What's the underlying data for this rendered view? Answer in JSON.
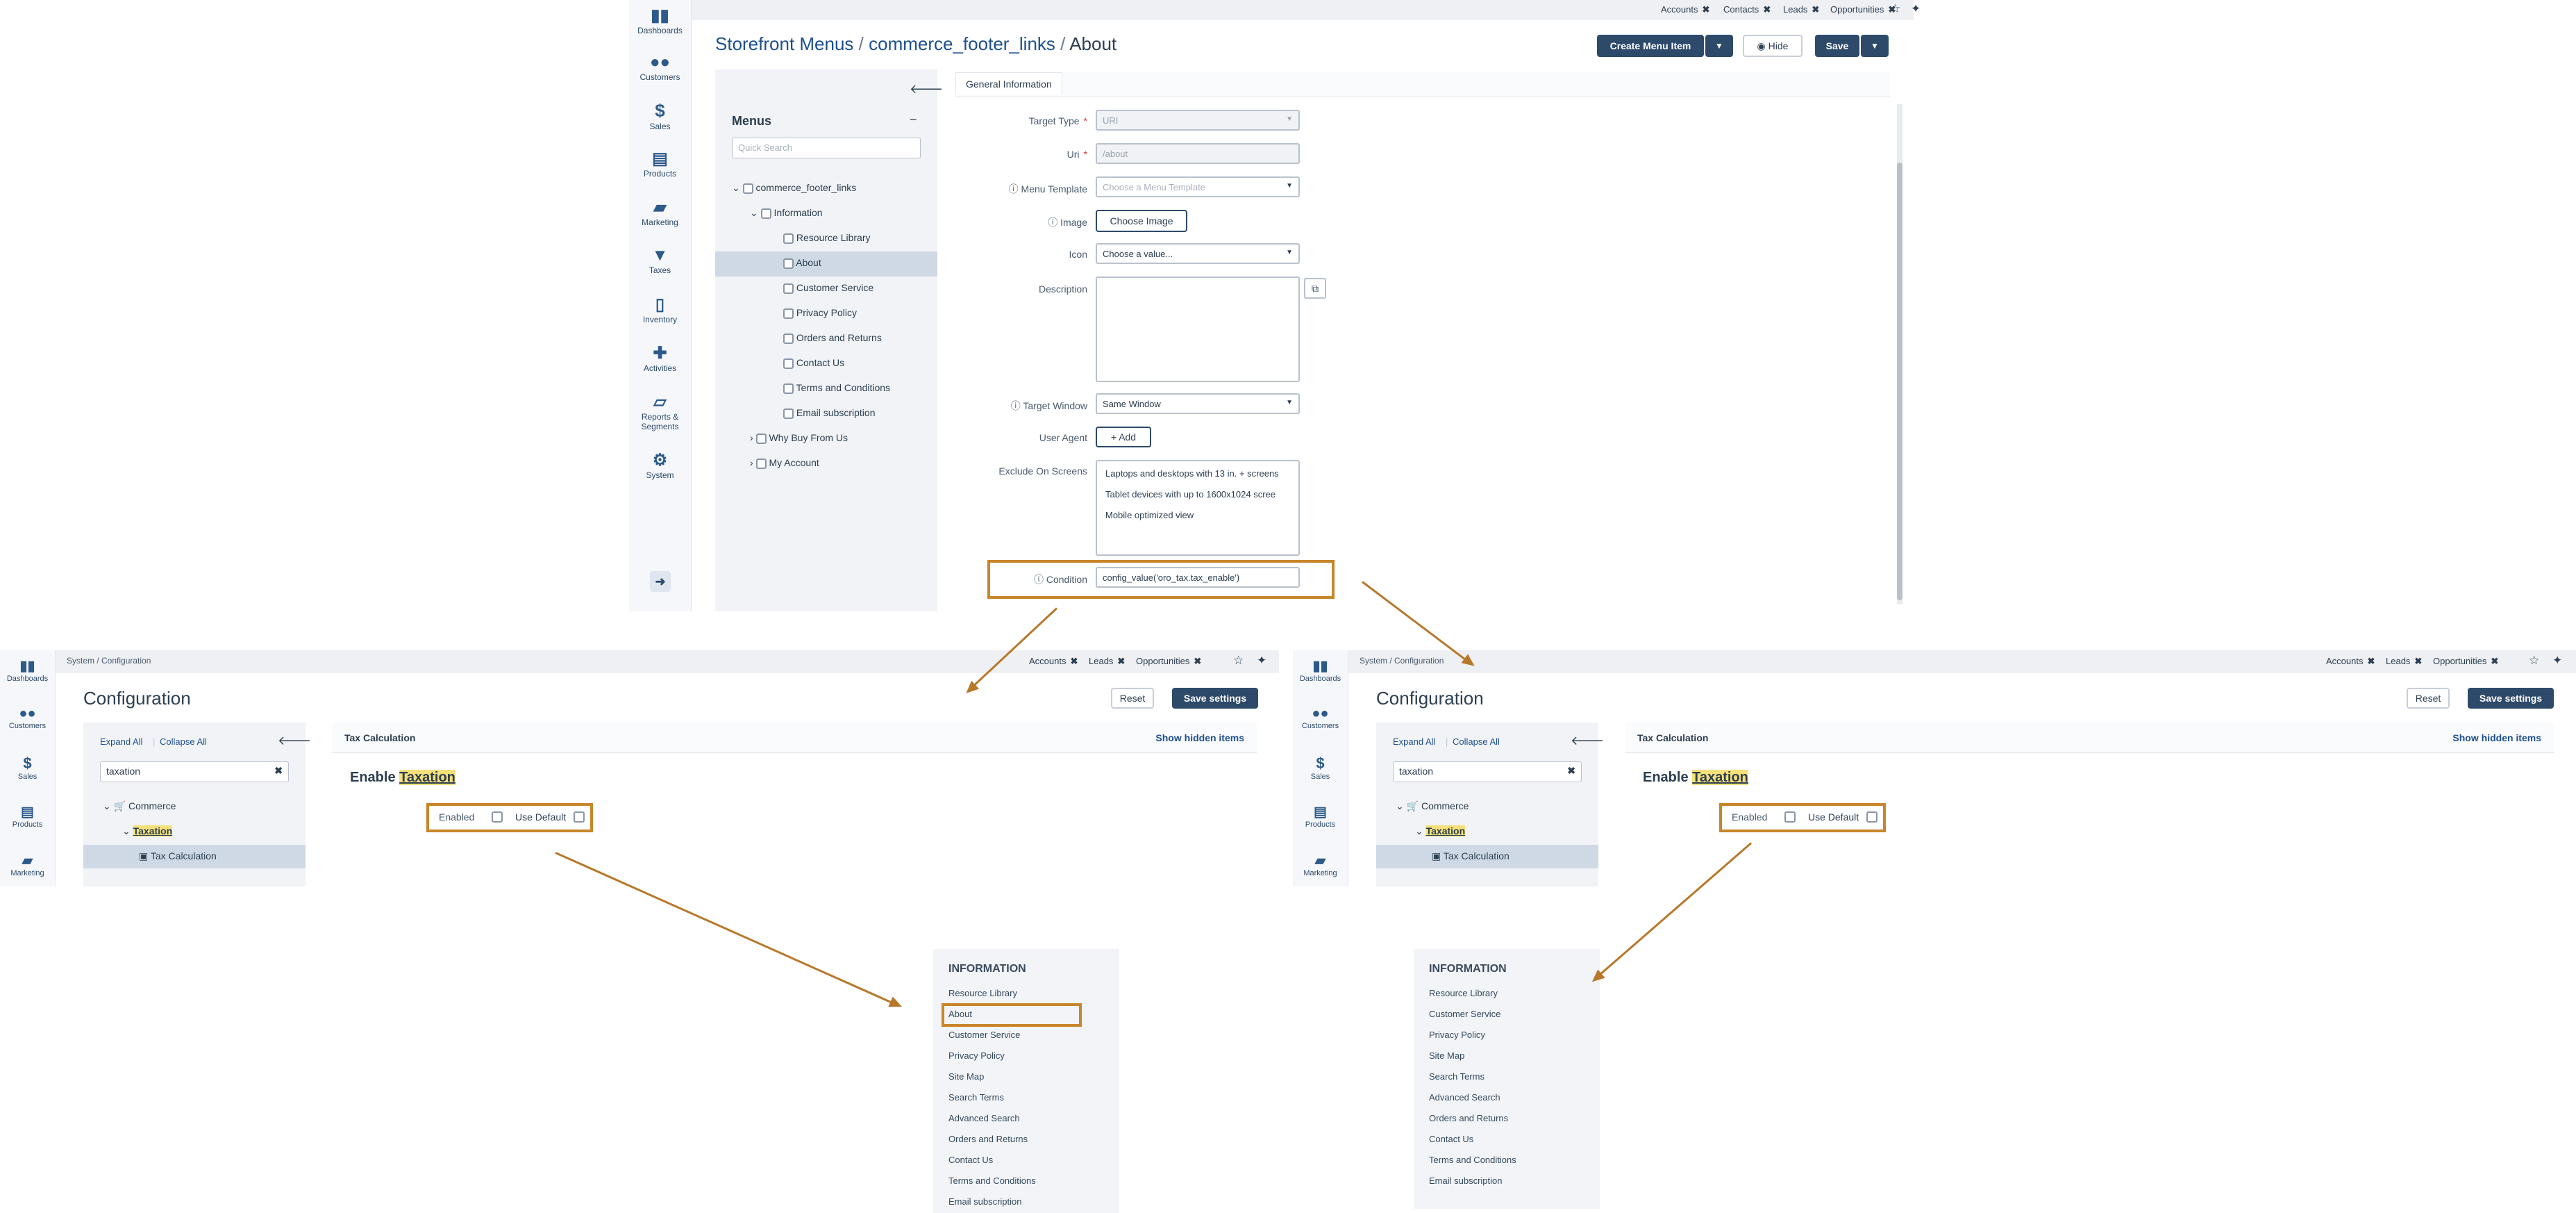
{
  "top": {
    "pinned_tabs": [
      "Accounts",
      "Contacts",
      "Leads",
      "Opportunities"
    ],
    "nav": [
      {
        "label": "Dashboards",
        "icon": "dashboards-icon"
      },
      {
        "label": "Customers",
        "icon": "customers-icon"
      },
      {
        "label": "Sales",
        "icon": "sales-icon"
      },
      {
        "label": "Products",
        "icon": "products-icon"
      },
      {
        "label": "Marketing",
        "icon": "marketing-icon"
      },
      {
        "label": "Taxes",
        "icon": "taxes-icon"
      },
      {
        "label": "Inventory",
        "icon": "inventory-icon"
      },
      {
        "label": "Activities",
        "icon": "activities-icon"
      },
      {
        "label": "Reports &",
        "label2": "Segments",
        "icon": "reports-icon"
      },
      {
        "label": "System",
        "icon": "system-icon"
      }
    ],
    "breadcrumb": {
      "part1": "Storefront Menus",
      "sep": "/",
      "part2": "commerce_footer_links",
      "part3": "About"
    },
    "buttons": {
      "create": "Create Menu Item",
      "hide": "Hide",
      "save": "Save"
    },
    "tree": {
      "title": "Menus",
      "search_placeholder": "Quick Search",
      "items": [
        "commerce_footer_links",
        "Information",
        "Resource Library",
        "About",
        "Customer Service",
        "Privacy Policy",
        "Orders and Returns",
        "Contact Us",
        "Terms and Conditions",
        "Email subscription",
        "Why Buy From Us",
        "My Account"
      ]
    },
    "tab": "General Information",
    "form": {
      "target_type_label": "Target Type",
      "target_type_value": "URI",
      "uri_label": "Uri",
      "uri_value": "/about",
      "menu_template_label": "Menu Template",
      "menu_template_placeholder": "Choose a Menu Template",
      "image_label": "Image",
      "image_button": "Choose Image",
      "icon_label": "Icon",
      "icon_value": "Choose a value...",
      "description_label": "Description",
      "target_window_label": "Target Window",
      "target_window_value": "Same Window",
      "user_agent_label": "User Agent",
      "user_agent_button": "Add",
      "exclude_label": "Exclude On Screens",
      "exclude_options": [
        "Laptops and desktops with 13 in. + screens",
        "Tablet devices with up to 1600x1024 scree",
        "Mobile optimized view"
      ],
      "condition_label": "Condition",
      "condition_value": "config_value('oro_tax.tax_enable')"
    }
  },
  "config_left": {
    "pinned_tabs": [
      "Accounts",
      "Leads",
      "Opportunities"
    ],
    "nav": [
      "Dashboards",
      "Customers",
      "Sales",
      "Products",
      "Marketing"
    ],
    "breadcrumb": "System / Configuration",
    "title": "Configuration",
    "reset": "Reset",
    "save": "Save settings",
    "expand_all": "Expand All",
    "collapse_all": "Collapse All",
    "search_value": "taxation",
    "tree": [
      "Commerce",
      "Taxation",
      "Tax Calculation"
    ],
    "section": "Tax Calculation",
    "show_hidden": "Show hidden items",
    "heading_prefix": "Enable",
    "heading_mark": "Taxation",
    "enabled_label": "Enabled",
    "use_default": "Use Default"
  },
  "config_right": {
    "pinned_tabs": [
      "Accounts",
      "Leads",
      "Opportunities"
    ],
    "nav": [
      "Dashboards",
      "Customers",
      "Sales",
      "Products",
      "Marketing"
    ],
    "breadcrumb": "System / Configuration",
    "title": "Configuration",
    "reset": "Reset",
    "save": "Save settings",
    "expand_all": "Expand All",
    "collapse_all": "Collapse All",
    "search_value": "taxation",
    "tree": [
      "Commerce",
      "Taxation",
      "Tax Calculation"
    ],
    "section": "Tax Calculation",
    "show_hidden": "Show hidden items",
    "heading_prefix": "Enable",
    "heading_mark": "Taxation",
    "enabled_label": "Enabled",
    "use_default": "Use Default"
  },
  "footer_left": {
    "title": "INFORMATION",
    "links": [
      "Resource Library",
      "About",
      "Customer Service",
      "Privacy Policy",
      "Site Map",
      "Search Terms",
      "Advanced Search",
      "Orders and Returns",
      "Contact Us",
      "Terms and Conditions",
      "Email subscription"
    ]
  },
  "footer_right": {
    "title": "INFORMATION",
    "links": [
      "Resource Library",
      "Customer Service",
      "Privacy Policy",
      "Site Map",
      "Search Terms",
      "Advanced Search",
      "Orders and Returns",
      "Contact Us",
      "Terms and Conditions",
      "Email subscription"
    ]
  },
  "colors": {
    "accent": "#2d4a6b",
    "highlight": "#c8862a",
    "link": "#1d4f91"
  }
}
